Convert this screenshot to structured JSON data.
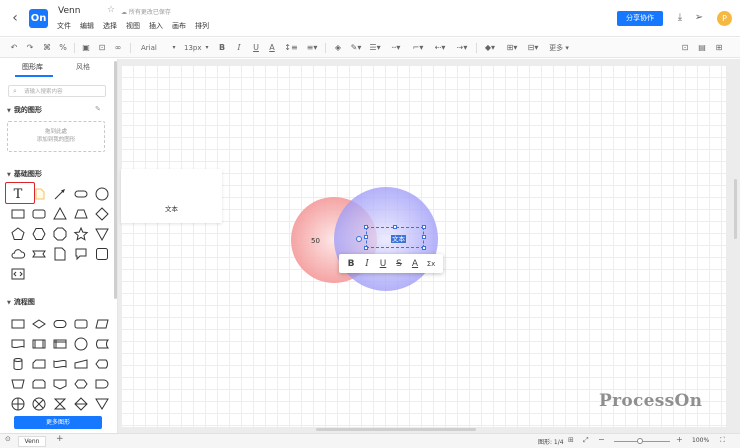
{
  "header": {
    "app_logo": "On",
    "doc_title": "Venn",
    "save_status": "所有更改已保存",
    "menu": [
      "文件",
      "编辑",
      "选择",
      "视图",
      "插入",
      "画布",
      "排列"
    ],
    "share_label": "分享协作",
    "avatar_initial": "P",
    "icons": [
      "back-icon",
      "star-icon",
      "download-icon",
      "send-icon",
      "fullscreen-icon"
    ]
  },
  "toolbar": {
    "font_family": "Arial",
    "font_size": "13px",
    "more_label": "更多",
    "bold": "B",
    "italic": "I",
    "underline": "U",
    "text_color": "A"
  },
  "left_panel": {
    "tabs": [
      "图形库",
      "风格"
    ],
    "search_placeholder": "请输入搜索内容",
    "my_shapes_title": "我的图形",
    "my_shapes_hint_line1": "拖到此處",
    "my_shapes_hint_line2": "添加到我的图形",
    "basic_shapes_title": "基础图形",
    "flowchart_title": "流程图",
    "more_shapes_label": "更多图形",
    "text_tool_glyph": "T"
  },
  "canvas": {
    "text_card_label": "文本",
    "venn_value": "50",
    "selected_text": "文本",
    "watermark": "ProcessOn",
    "colors": {
      "left_circle": "#f49a9a",
      "right_circle": "#9f9cf7",
      "overlap": "#b8a1e6"
    },
    "text_toolbar": [
      "B",
      "I",
      "U",
      "S",
      "A",
      "Σx"
    ]
  },
  "bottom_bar": {
    "page_tab": "Venn",
    "add_page": "+",
    "shape_count": "图形: 1/4",
    "zoom": "100%"
  }
}
